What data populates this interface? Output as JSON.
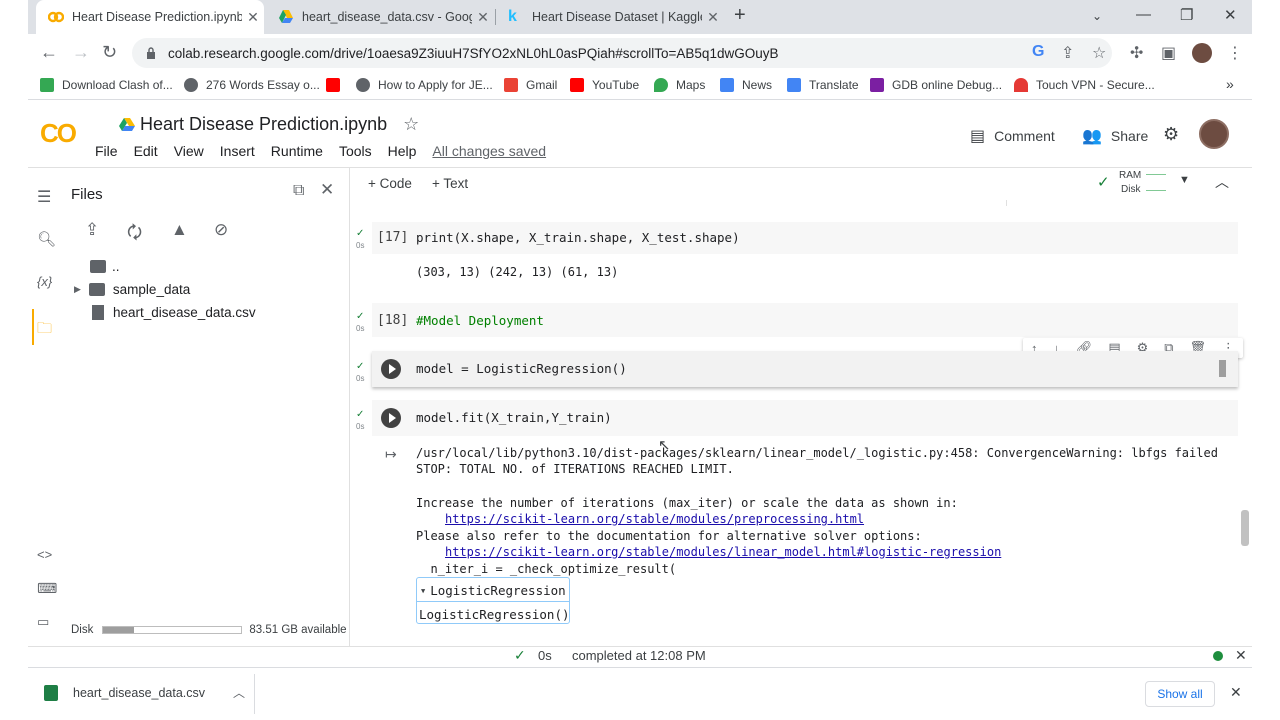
{
  "browser": {
    "tabs": [
      {
        "title": "Heart Disease Prediction.ipynb - ",
        "icon": "colab-icon"
      },
      {
        "title": "heart_disease_data.csv - Google",
        "icon": "google-drive-icon"
      },
      {
        "title": "Heart Disease Dataset | Kaggle",
        "icon": "kaggle-icon"
      }
    ],
    "url": "colab.research.google.com/drive/1oaesa9Z3iuuH7SfYO2xNL0hL0asPQiah#scrollTo=AB5q1dwGOuyB",
    "bookmarks": [
      {
        "label": "Download Clash of...",
        "color": "#34a853"
      },
      {
        "label": "276 Words Essay o...",
        "color": "#5f6368"
      },
      {
        "label": "",
        "color": "#ff0000"
      },
      {
        "label": "How to Apply for JE...",
        "color": "#5f6368"
      },
      {
        "label": "Gmail",
        "color": "#ea4335"
      },
      {
        "label": "YouTube",
        "color": "#ff0000"
      },
      {
        "label": "Maps",
        "color": "#34a853"
      },
      {
        "label": "News",
        "color": "#4285f4"
      },
      {
        "label": "Translate",
        "color": "#4285f4"
      },
      {
        "label": "GDB online Debug...",
        "color": "#7b1fa2"
      },
      {
        "label": "Touch VPN - Secure...",
        "color": "#e53935"
      }
    ],
    "more_bookmarks": "»"
  },
  "colab": {
    "logo": "CO",
    "title": "Heart Disease Prediction.ipynb",
    "menu": [
      "File",
      "Edit",
      "View",
      "Insert",
      "Runtime",
      "Tools",
      "Help"
    ],
    "saved": "All changes saved",
    "comment": "Comment",
    "share": "Share",
    "add_code": "+ Code",
    "add_text": "+ Text",
    "ram": "RAM",
    "disk": "Disk"
  },
  "files": {
    "title": "Files",
    "tree": [
      {
        "name": "..",
        "type": "parent"
      },
      {
        "name": "sample_data",
        "type": "folder"
      },
      {
        "name": "heart_disease_data.csv",
        "type": "file"
      }
    ],
    "disk_label": "Disk",
    "disk_used_fraction": 0.22,
    "disk_available": "83.51 GB available"
  },
  "cells": {
    "c17": {
      "prompt": "[17]",
      "time": "0s",
      "code": "print(X.shape, X_train.shape, X_test.shape)",
      "output": "(303, 13) (242, 13) (61, 13)"
    },
    "c18": {
      "prompt": "[18]",
      "time": "0s",
      "code": "#Model Deployment"
    },
    "c19": {
      "time": "0s",
      "code": "model = LogisticRegression()"
    },
    "c20": {
      "time": "0s",
      "code": "model.fit(X_train,Y_train)",
      "out1": "/usr/local/lib/python3.10/dist-packages/sklearn/linear_model/_logistic.py:458: ConvergenceWarning: lbfgs failed",
      "out2": "STOP: TOTAL NO. of ITERATIONS REACHED LIMIT.",
      "out3": "Increase the number of iterations (max_iter) or scale the data as shown in:",
      "link1": "https://scikit-learn.org/stable/modules/preprocessing.html",
      "out4": "Please also refer to the documentation for alternative solver options:",
      "link2": "https://scikit-learn.org/stable/modules/linear_model.html#logistic-regression",
      "out5": "  n_iter_i = _check_optimize_result(",
      "repr_header": "LogisticRegression",
      "repr_body": "LogisticRegression()"
    }
  },
  "status": {
    "time": "0s",
    "message": "completed at 12:08 PM"
  },
  "downloads": {
    "file": "heart_disease_data.csv",
    "show_all": "Show all"
  }
}
